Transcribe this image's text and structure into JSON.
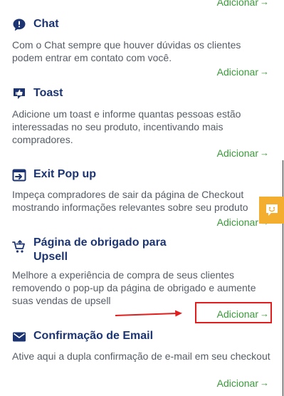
{
  "top_link": {
    "label": "Adicionar",
    "arrow": "→"
  },
  "features": [
    {
      "icon": "chat-bubble-exclamation-icon",
      "title": "Chat",
      "description": "Com o Chat sempre que houver dúvidas os clientes podem entrar em contato com você.",
      "action_label": "Adicionar",
      "action_arrow": "→"
    },
    {
      "icon": "toast-thumbs-up-icon",
      "title": "Toast",
      "description": "Adicione um toast e informe quantas pessoas estão interessadas no seu produto, incentivando mais compradores.",
      "action_label": "Adicionar",
      "action_arrow": "→"
    },
    {
      "icon": "exit-popup-icon",
      "title": "Exit Pop up",
      "description": "Impeça compradores de sair da página de Checkout mostrando informações relevantes sobre seu produto",
      "action_label": "Adicionar",
      "action_arrow": "→"
    },
    {
      "icon": "cart-upsell-icon",
      "title": "Página de obrigado para Upsell",
      "description": "Melhore a experiência de compra de seus clientes removendo o pop-up da página de obrigado e aumente suas vendas de upsell",
      "action_label": "Adicionar",
      "action_arrow": "→"
    },
    {
      "icon": "envelope-icon",
      "title": "Confirmação de Email",
      "description": "Ative aqui a dupla confirmação de e-mail em seu checkout",
      "action_label": "Adicionar",
      "action_arrow": "→"
    }
  ],
  "side_tab": {
    "icon": "smiley-chat-icon"
  },
  "colors": {
    "title": "#1c3472",
    "description": "#555c66",
    "link": "#3a9a3a",
    "side_tab": "#f4ae2f",
    "highlight": "#e21d1d"
  }
}
